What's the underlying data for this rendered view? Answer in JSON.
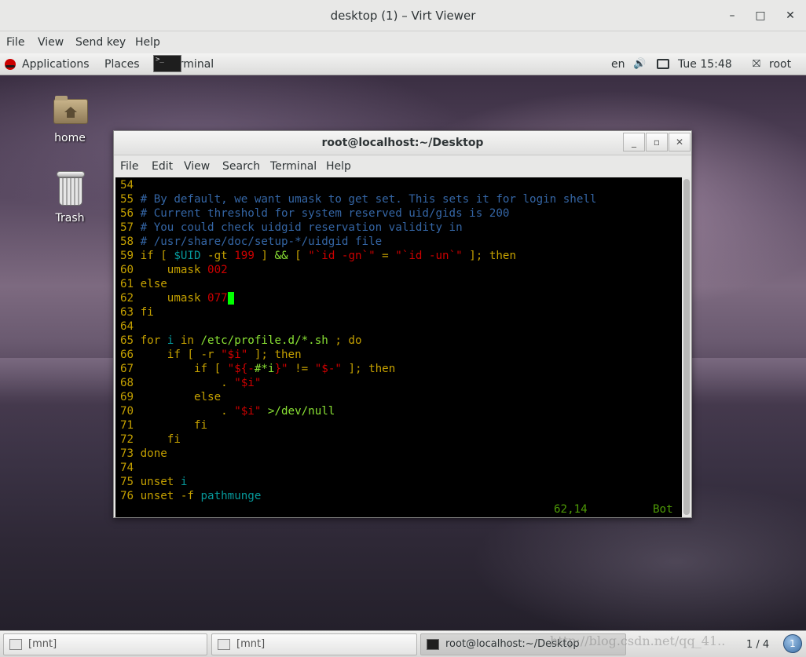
{
  "window": {
    "title": "desktop (1) – Virt Viewer",
    "minimize_glyph": "–",
    "maximize_glyph": "□",
    "close_glyph": "✕"
  },
  "viewer_menu": [
    "File",
    "View",
    "Send key",
    "Help"
  ],
  "gnome_panel": {
    "applications": "Applications",
    "places": "Places",
    "active_app": "Terminal",
    "language": "en",
    "volume_icon": "🔊",
    "clock": "Tue 15:48",
    "user": "root",
    "user_icon": "⛝"
  },
  "desktop_icons": [
    {
      "label": "home",
      "icon": "home-folder-icon"
    },
    {
      "label": "Trash",
      "icon": "trash-icon"
    }
  ],
  "terminal": {
    "title": "root@localhost:~/Desktop",
    "menu": [
      "File",
      "Edit",
      "View",
      "Search",
      "Terminal",
      "Help"
    ],
    "lines": [
      [
        {
          "t": "54 ",
          "c": "ln"
        }
      ],
      [
        {
          "t": "55 ",
          "c": "ln"
        },
        {
          "t": "# By default, we want umask to get set. This sets it for login shell",
          "c": "cm"
        }
      ],
      [
        {
          "t": "56 ",
          "c": "ln"
        },
        {
          "t": "# Current threshold for system reserved uid/gids is 200",
          "c": "cm"
        }
      ],
      [
        {
          "t": "57 ",
          "c": "ln"
        },
        {
          "t": "# You could check uidgid reservation validity in",
          "c": "cm"
        }
      ],
      [
        {
          "t": "58 ",
          "c": "ln"
        },
        {
          "t": "# /usr/share/doc/setup-*/uidgid file",
          "c": "cm"
        }
      ],
      [
        {
          "t": "59 ",
          "c": "ln"
        },
        {
          "t": "if [ ",
          "c": "kw"
        },
        {
          "t": "$UID",
          "c": "vr"
        },
        {
          "t": " -gt ",
          "c": "kw"
        },
        {
          "t": "199",
          "c": "st"
        },
        {
          "t": " ] ",
          "c": "kw"
        },
        {
          "t": "&&",
          "c": "lg"
        },
        {
          "t": " [ ",
          "c": "kw"
        },
        {
          "t": "\"`id -gn`\"",
          "c": "st"
        },
        {
          "t": " = ",
          "c": "kw"
        },
        {
          "t": "\"`id -un`\"",
          "c": "st"
        },
        {
          "t": " ]; then",
          "c": "kw"
        }
      ],
      [
        {
          "t": "60 ",
          "c": "ln"
        },
        {
          "t": "    umask ",
          "c": "kw"
        },
        {
          "t": "002",
          "c": "st"
        }
      ],
      [
        {
          "t": "61 ",
          "c": "ln"
        },
        {
          "t": "else",
          "c": "kw"
        }
      ],
      [
        {
          "t": "62 ",
          "c": "ln"
        },
        {
          "t": "    umask ",
          "c": "kw"
        },
        {
          "t": "077",
          "c": "st"
        },
        {
          "t": " ",
          "c": "cursor"
        }
      ],
      [
        {
          "t": "63 ",
          "c": "ln"
        },
        {
          "t": "fi",
          "c": "kw"
        }
      ],
      [
        {
          "t": "64 ",
          "c": "ln"
        }
      ],
      [
        {
          "t": "65 ",
          "c": "ln"
        },
        {
          "t": "for ",
          "c": "kw"
        },
        {
          "t": "i",
          "c": "vr"
        },
        {
          "t": " in ",
          "c": "kw"
        },
        {
          "t": "/etc/profile.d/*.sh",
          "c": "lg"
        },
        {
          "t": " ; do",
          "c": "kw"
        }
      ],
      [
        {
          "t": "66 ",
          "c": "ln"
        },
        {
          "t": "    if [ -r ",
          "c": "kw"
        },
        {
          "t": "\"$i\"",
          "c": "st"
        },
        {
          "t": " ]; then",
          "c": "kw"
        }
      ],
      [
        {
          "t": "67 ",
          "c": "ln"
        },
        {
          "t": "        if [ ",
          "c": "kw"
        },
        {
          "t": "\"${-",
          "c": "st"
        },
        {
          "t": "#*i",
          "c": "lg"
        },
        {
          "t": "}\"",
          "c": "st"
        },
        {
          "t": " != ",
          "c": "kw"
        },
        {
          "t": "\"$-\"",
          "c": "st"
        },
        {
          "t": " ]; then",
          "c": "kw"
        }
      ],
      [
        {
          "t": "68 ",
          "c": "ln"
        },
        {
          "t": "            . ",
          "c": "kw"
        },
        {
          "t": "\"$i\"",
          "c": "st"
        }
      ],
      [
        {
          "t": "69 ",
          "c": "ln"
        },
        {
          "t": "        else",
          "c": "kw"
        }
      ],
      [
        {
          "t": "70 ",
          "c": "ln"
        },
        {
          "t": "            . ",
          "c": "kw"
        },
        {
          "t": "\"$i\"",
          "c": "st"
        },
        {
          "t": " >/dev/null",
          "c": "lg"
        }
      ],
      [
        {
          "t": "71 ",
          "c": "ln"
        },
        {
          "t": "        fi",
          "c": "kw"
        }
      ],
      [
        {
          "t": "72 ",
          "c": "ln"
        },
        {
          "t": "    fi",
          "c": "kw"
        }
      ],
      [
        {
          "t": "73 ",
          "c": "ln"
        },
        {
          "t": "done",
          "c": "kw"
        }
      ],
      [
        {
          "t": "74 ",
          "c": "ln"
        }
      ],
      [
        {
          "t": "75 ",
          "c": "ln"
        },
        {
          "t": "unset ",
          "c": "kw"
        },
        {
          "t": "i",
          "c": "vr"
        }
      ],
      [
        {
          "t": "76 ",
          "c": "ln"
        },
        {
          "t": "unset -f ",
          "c": "kw"
        },
        {
          "t": "pathmunge",
          "c": "vr"
        }
      ]
    ],
    "status_position": "62,14",
    "status_scroll": "Bot"
  },
  "taskbar": {
    "tasks": [
      {
        "label": "[mnt]",
        "active": false
      },
      {
        "label": "[mnt]",
        "active": false
      },
      {
        "label": "root@localhost:~/Desktop",
        "active": true
      }
    ],
    "workspace": "1 / 4",
    "workspace_badge": "1",
    "watermark": "http://blog.csdn.net/qq_41.."
  }
}
